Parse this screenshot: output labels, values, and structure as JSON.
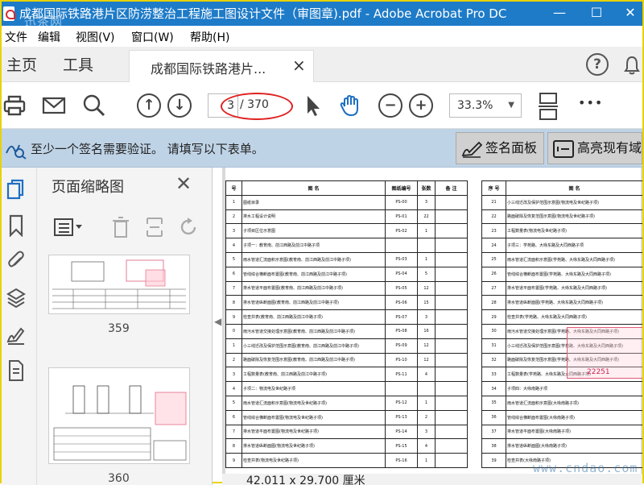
{
  "window": {
    "title": "成都国际铁路港片区防涝整治工程施工图设计文件（审图章).pdf - Adobe Acrobat Pro DC",
    "overlay_watermark": "迅茶网",
    "minimize": "—",
    "maximize": "☐",
    "close": "✕"
  },
  "menu": {
    "items": [
      {
        "label": "文件"
      },
      {
        "label": "编辑"
      },
      {
        "label": "视图(V)"
      },
      {
        "label": "窗口(W)"
      },
      {
        "label": "帮助(H)"
      }
    ]
  },
  "tabs": {
    "home": "主页",
    "tools": "工具",
    "document": "成都国际铁路港片...",
    "help_glyph": "?"
  },
  "toolbar": {
    "page_current": "3",
    "page_total": "/ 370",
    "zoom": "33.3%",
    "more": "•••"
  },
  "signature_bar": {
    "message": "至少一个签名需要验证。 请填写以下表单。",
    "sign_panel": "签名面板",
    "highlight_fields": "高亮现有域"
  },
  "thumbnails": {
    "header": "页面缩略图",
    "close": "✕",
    "pages": [
      "359",
      "360"
    ]
  },
  "document": {
    "size_status": "42.011 x 29.700 厘米",
    "left_headers": [
      "号",
      "图 名",
      "图纸编号",
      "张数",
      "备 注"
    ],
    "left_rows": [
      [
        "1",
        "图纸目录",
        "PS-00",
        "3",
        ""
      ],
      [
        "2",
        "排水工程设计说明",
        "PS-01",
        "22",
        ""
      ],
      [
        "3",
        "子项目区位示意图",
        "PS-02",
        "1",
        ""
      ],
      [
        "4",
        "子项一：教育南、前江西路及前江中路子项",
        "",
        "",
        ""
      ],
      [
        "5",
        "雨水管道汇流面积示意图(教育南、前江西路及前江中路子项)",
        "PS-03",
        "1",
        ""
      ],
      [
        "6",
        "管线综合横断面布置图(教育南、前江西路及前江中路子项)",
        "PS-04",
        "5",
        ""
      ],
      [
        "7",
        "排水管道平面布置图(教育南、前江西路及前江中路子项)",
        "PS-05",
        "12",
        ""
      ],
      [
        "8",
        "排水管道纵断面图(教育南、前江西路及前江中路子项)",
        "PS-06",
        "15",
        ""
      ],
      [
        "9",
        "检查井表(教育南、前江西路及前江中路子项)",
        "PS-07",
        "3",
        ""
      ],
      [
        "0",
        "雨污水管道交接处理示意图(教育南、前江西路及前江中路子项)",
        "PS-08",
        "16",
        ""
      ],
      [
        "1",
        "小三线迁改及保护范围示意图(教育南、前江西路及前江中路子项)",
        "PS-09",
        "12",
        ""
      ],
      [
        "2",
        "路面破除及恢复范围示意图(教育南、前江西路及前江中路子项)",
        "PS-10",
        "12",
        ""
      ],
      [
        "3",
        "工程数量表(教育南、前江西路及前江中路子项)",
        "PS-11",
        "4",
        ""
      ],
      [
        "4",
        "子项二：物流电及世纪路子项",
        "",
        "",
        ""
      ],
      [
        "5",
        "雨水管道汇流面积示意图(物流电及世纪路子项)",
        "PS-12",
        "1",
        ""
      ],
      [
        "6",
        "管线综合横断面布置图(物流电及世纪路子项)",
        "PS-13",
        "2",
        ""
      ],
      [
        "7",
        "排水管道平面布置图(物流电及世纪路子项)",
        "PS-14",
        "3",
        ""
      ],
      [
        "8",
        "排水管道纵断面图(物流电及世纪路子项)",
        "PS-15",
        "4",
        ""
      ],
      [
        "9",
        "检查井表(物流电及世纪路子项)",
        "PS-16",
        "1",
        ""
      ]
    ],
    "right_headers": [
      "序 号",
      "图 名"
    ],
    "right_rows": [
      [
        "21",
        "小三线迁改及保护范围示意图(物流电及世纪路子项)"
      ],
      [
        "22",
        "路面破除及恢复范围示意图(物流电及世纪路子项)"
      ],
      [
        "23",
        "工程数量表(物流电及世纪路子项)"
      ],
      [
        "24",
        "子项三：学苑路、大咏东路及大同西路子项"
      ],
      [
        "25",
        "雨水管道汇流面积示意图(学苑路、大咏东路及大同西路子项)"
      ],
      [
        "26",
        "管线综合横断面布置图(学苑路、大咏东路及大同西路子项)"
      ],
      [
        "27",
        "排水管道平面布置图(学苑路、大咏东路及大同西路子项)"
      ],
      [
        "28",
        "排水管道纵断面图(学苑路、大咏东路及大同西路子项)"
      ],
      [
        "29",
        "检查井表(学苑路、大咏东路及大同西路子项)"
      ],
      [
        "30",
        "雨污水管道交接处理示意图(学苑路、大咏东路及大同西路子项)"
      ],
      [
        "31",
        "小三线迁改及保护范围示意图(学苑路、大咏东路及大同西路子项)"
      ],
      [
        "32",
        "路面破除及恢复范围示意图(学苑路、大咏东路及大同西路子项)"
      ],
      [
        "33",
        "工程数量表(学苑路、大咏东路及大同西路子项)"
      ],
      [
        "34",
        "子项四：大咏南路子项"
      ],
      [
        "35",
        "雨水管道汇流面积示意图(大咏南路子项)"
      ],
      [
        "36",
        "管线综合横断面布置图(大咏南路子项)"
      ],
      [
        "37",
        "排水管道平面布置图(大咏南路子项)"
      ],
      [
        "38",
        "排水管道纵断面图(大咏南路子项)"
      ],
      [
        "39",
        "检查井表(大咏南路子项)"
      ]
    ],
    "stamp_text": "22251"
  },
  "site_watermark": "www.cndao.com",
  "colors": {
    "titlebar": "#1e7bc8",
    "sigbar": "#bfd3e6",
    "accent_red": "#e02020",
    "stamp": "#e05b7a"
  }
}
